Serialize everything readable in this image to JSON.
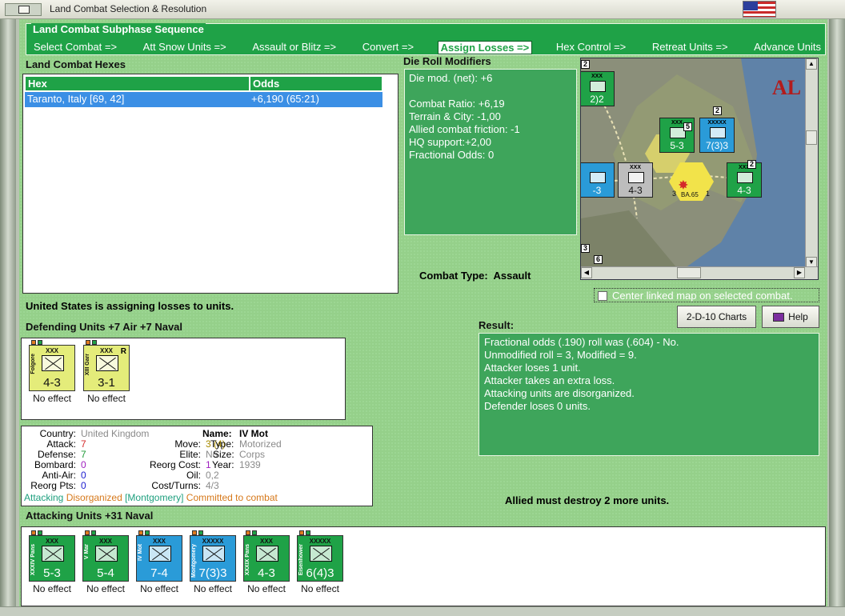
{
  "window": {
    "title": "Land Combat Selection & Resolution"
  },
  "phase": {
    "legend": "Land Combat Subphase Sequence",
    "steps": [
      "Select Combat =>",
      "Att Snow Units =>",
      "Assault or Blitz =>",
      "Convert =>",
      "Assign Losses =>",
      "Hex Control =>",
      "Retreat Units =>",
      "Advance Units"
    ],
    "active_index": 4
  },
  "hexes": {
    "title": "Land Combat Hexes",
    "col_hex": "Hex",
    "col_odds": "Odds",
    "rows": [
      {
        "hex": "Taranto, Italy [69, 42]",
        "odds": "+6,190 (65:21)"
      }
    ]
  },
  "die_roll": {
    "title": "Die Roll Modifiers",
    "lines": [
      "Die mod. (net): +6",
      "",
      "Combat Ratio: +6,19",
      "Terrain & City: -1,00",
      "Allied combat friction: -1",
      "HQ support:+2,00",
      "Fractional Odds: 0"
    ]
  },
  "map": {
    "label": "AL",
    "counters": [
      {
        "str": "5-3",
        "size": "XXX",
        "color": "#1fa247"
      },
      {
        "str": "7(3)3",
        "size": "XXXXX",
        "color": "#2a9bd8"
      },
      {
        "str": "4-3",
        "size": "XXX",
        "color": "#bdbdbd"
      },
      {
        "str": "4-3",
        "size": "XXX",
        "color": "#1fa247"
      },
      {
        "str": "2)2",
        "size": "XXX",
        "color": "#1fa247"
      },
      {
        "str": "-3",
        "size": "",
        "color": "#2a9bd8"
      }
    ],
    "stack_labels": [
      "2",
      "5",
      "2",
      "2",
      "3",
      "6"
    ],
    "hex_text": "BA.65",
    "hex_left_num": "3",
    "hex_right_num": "1"
  },
  "combat_type": {
    "label": "Combat Type:",
    "value": "Assault"
  },
  "center_linked": {
    "label": "Center linked map on selected combat.",
    "checked": false
  },
  "status": "United States is assigning losses to units.",
  "buttons": {
    "charts": "2-D-10 Charts",
    "help": "Help"
  },
  "defending": {
    "title": "Defending Units +7 Air +7 Naval",
    "units": [
      {
        "name": "Folgore",
        "size": "XXX",
        "str": "4-3",
        "note": "No effect",
        "color": "#e4ec7a",
        "text_color": "#111"
      },
      {
        "name": "XIII Garr",
        "size": "XXX",
        "str": "3-1",
        "note": "No effect",
        "color": "#e4ec7a",
        "text_color": "#111",
        "badge": "R"
      }
    ]
  },
  "result": {
    "title": "Result:",
    "lines": [
      "Fractional odds (.190) roll was (.604)  - No.",
      "Unmodified roll = 3, Modified = 9.",
      "Attacker loses 1 unit.",
      "Attacker takes an extra loss.",
      "Attacking units are disorganized.",
      "Defender loses 0 units."
    ]
  },
  "detail": {
    "country_k": "Country:",
    "country_v": "United Kingdom",
    "attack_k": "Attack:",
    "attack_v": "7",
    "defense_k": "Defense:",
    "defense_v": "7",
    "bombard_k": "Bombard:",
    "bombard_v": "0",
    "antiair_k": "Anti-Air:",
    "antiair_v": "0",
    "reorg_k": "Reorg Pts:",
    "reorg_v": "0",
    "name_k": "Name:",
    "name_v": "IV Mot",
    "move_k": "Move:",
    "move_v": "3 (4)",
    "type_k": "Type:",
    "type_v": "Motorized",
    "elite_k": "Elite:",
    "elite_v": "No",
    "size_k": "Size:",
    "size_v": "Corps",
    "reorgcost_k": "Reorg Cost:",
    "reorgcost_v": "1",
    "year_k": "Year:",
    "year_v": "1939",
    "oil_k": "Oil:",
    "oil_v": "0,2",
    "cost_k": "Cost/Turns:",
    "cost_v": "4/3",
    "tag1": "Attacking",
    "tag2": "Disorganized",
    "tag3": "[Montgomery]",
    "tag4": "Committed to combat"
  },
  "must_destroy": "Allied must destroy 2 more units.",
  "attacking": {
    "title": "Attacking Units +31 Naval",
    "units": [
      {
        "name": "XXXIV Pans",
        "size": "XXX",
        "str": "5-3",
        "note": "No effect",
        "color": "#1fa247",
        "text_color": "#fff"
      },
      {
        "name": "V Mar",
        "size": "XXX",
        "str": "5-4",
        "note": "No effect",
        "color": "#1fa247",
        "text_color": "#fff"
      },
      {
        "name": "IV Mot",
        "size": "XXX",
        "str": "7-4",
        "note": "No effect",
        "color": "#2a9bd8",
        "text_color": "#fff"
      },
      {
        "name": "Montgomery",
        "size": "XXXXX",
        "str": "7(3)3",
        "note": "No effect",
        "color": "#2a9bd8",
        "text_color": "#fff"
      },
      {
        "name": "XXXIX Pans",
        "size": "XXX",
        "str": "4-3",
        "note": "No effect",
        "color": "#1fa247",
        "text_color": "#fff"
      },
      {
        "name": "Eisenhower",
        "size": "XXXXX",
        "str": "6(4)3",
        "note": "No effect",
        "color": "#1fa247",
        "text_color": "#fff"
      }
    ]
  }
}
